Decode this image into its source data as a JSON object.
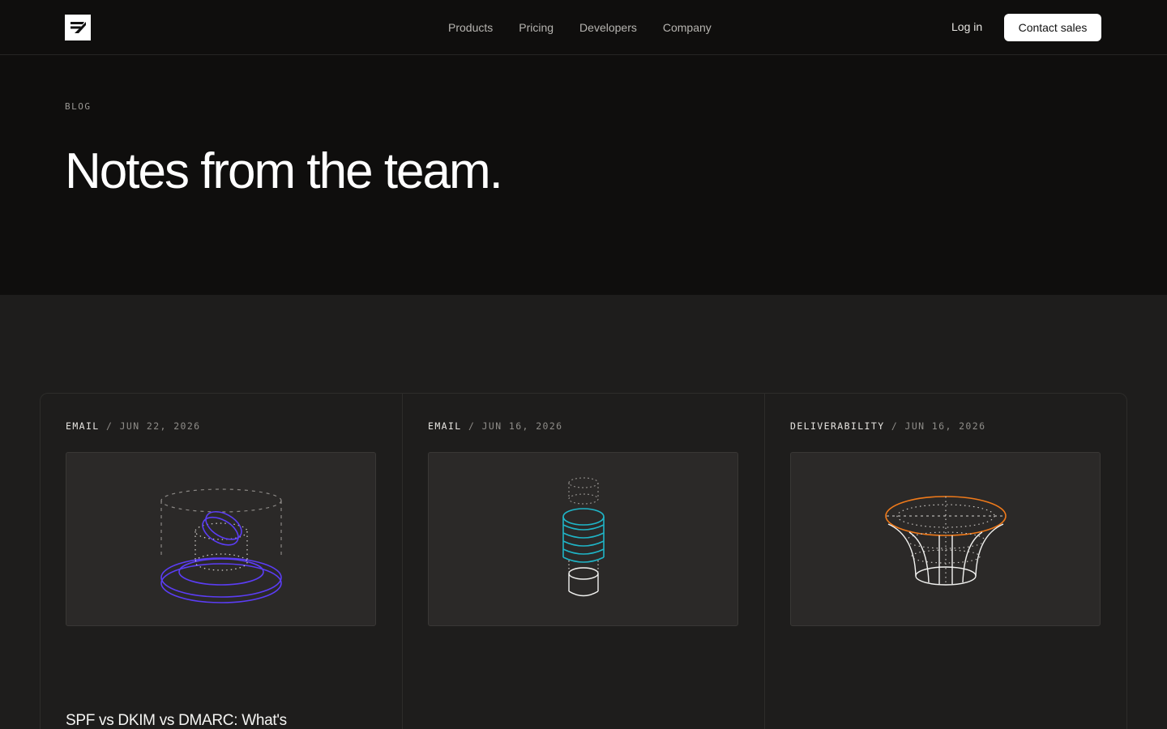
{
  "nav": {
    "links": [
      "Products",
      "Pricing",
      "Developers",
      "Company"
    ],
    "login_label": "Log in",
    "contact_label": "Contact sales"
  },
  "hero": {
    "eyebrow": "BLOG",
    "title": "Notes from the team."
  },
  "posts": [
    {
      "category": "EMAIL",
      "separator": "/",
      "date": "JUN 22, 2026",
      "title": "SPF vs DKIM vs DMARC: What's",
      "accent": "#5b3df5"
    },
    {
      "category": "EMAIL",
      "separator": "/",
      "date": "JUN 16, 2026",
      "title": "",
      "accent": "#1fb5c7"
    },
    {
      "category": "DELIVERABILITY",
      "separator": "/",
      "date": "JUN 16, 2026",
      "title": "",
      "accent": "#f07a1a"
    }
  ]
}
